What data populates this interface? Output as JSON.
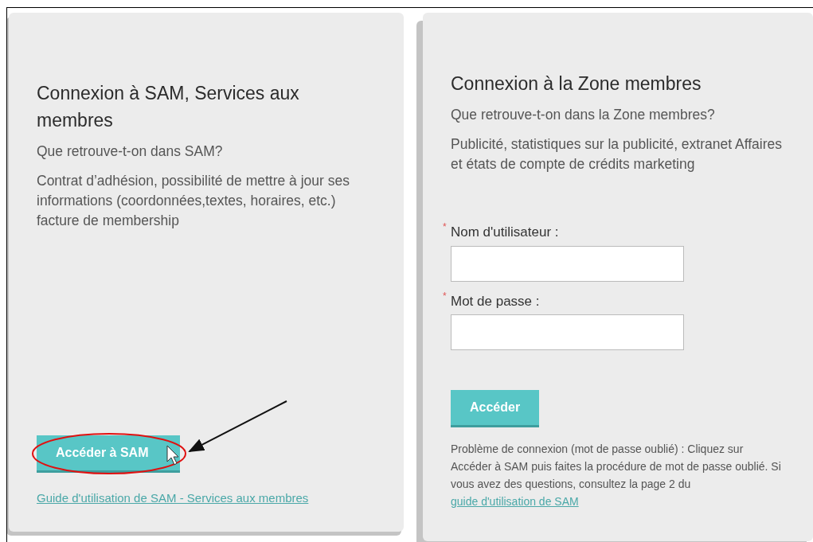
{
  "left_panel": {
    "title": "Connexion à SAM, Services aux membres",
    "question": "Que retrouve-t-on dans SAM?",
    "description": "Contrat d’adhésion, possibilité de mettre à jour ses informations (coordonnées,textes, horaires, etc.) facture de membership",
    "button": "Accéder à SAM",
    "link": "Guide d'utilisation de SAM - Services aux membres"
  },
  "right_panel": {
    "title": "Connexion à la Zone membres",
    "question": "Que retrouve-t-on dans la Zone membres?",
    "description": "Publicité, statistiques sur la publicité, extranet Affaires et états de compte de crédits marketing",
    "fields": [
      {
        "label": "Nom d'utilisateur :",
        "required_mark": "*"
      },
      {
        "label": "Mot de passe :",
        "required_mark": "*"
      }
    ],
    "button": "Accéder",
    "help_text": "Problème de connexion (mot de passe oublié) :  Cliquez sur Accéder à SAM puis faites la procédure de mot de passe oublié. Si vous avez des questions, consultez la page 2 du ",
    "help_link": "guide d'utilisation de SAM"
  }
}
